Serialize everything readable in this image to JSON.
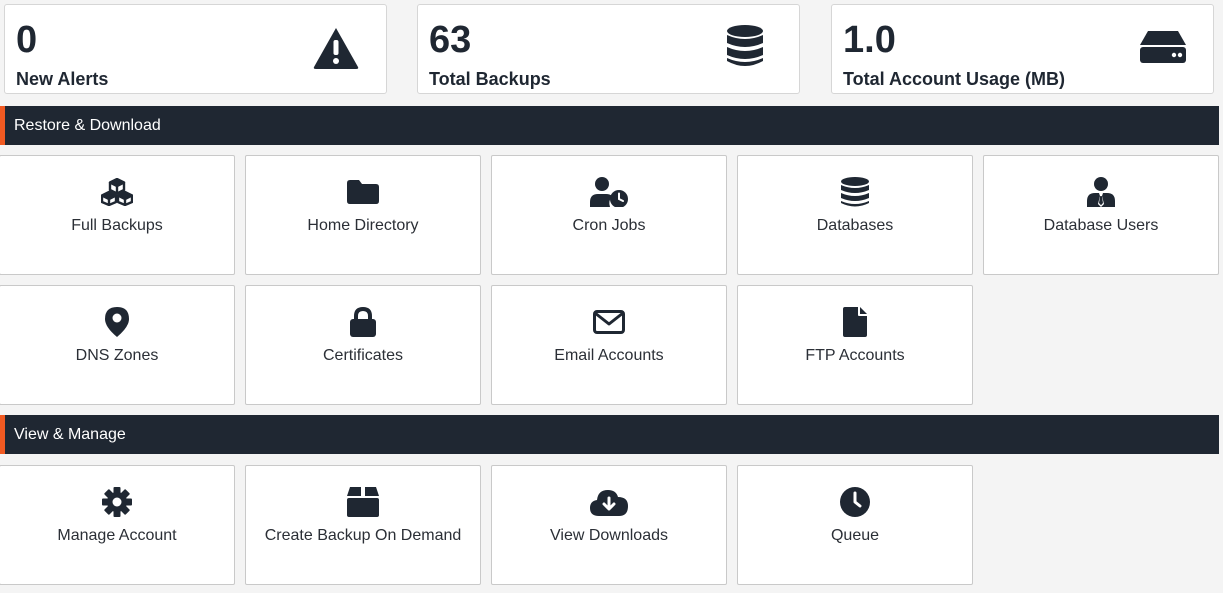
{
  "stats": [
    {
      "value": "0",
      "label": "New Alerts",
      "icon": "warning-icon"
    },
    {
      "value": "63",
      "label": "Total Backups",
      "icon": "database-icon"
    },
    {
      "value": "1.0",
      "label": "Total Account Usage (MB)",
      "icon": "hard-drive-icon"
    }
  ],
  "sections": {
    "restore": {
      "title": "Restore & Download",
      "tiles": [
        {
          "label": "Full Backups",
          "icon": "cubes-icon"
        },
        {
          "label": "Home Directory",
          "icon": "folder-icon"
        },
        {
          "label": "Cron Jobs",
          "icon": "user-clock-icon"
        },
        {
          "label": "Databases",
          "icon": "database-icon"
        },
        {
          "label": "Database Users",
          "icon": "user-tie-icon"
        },
        {
          "label": "DNS Zones",
          "icon": "map-marker-icon"
        },
        {
          "label": "Certificates",
          "icon": "lock-icon"
        },
        {
          "label": "Email Accounts",
          "icon": "envelope-icon"
        },
        {
          "label": "FTP Accounts",
          "icon": "file-icon"
        }
      ]
    },
    "manage": {
      "title": "View & Manage",
      "tiles": [
        {
          "label": "Manage Account",
          "icon": "gear-icon"
        },
        {
          "label": "Create Backup On Demand",
          "icon": "box-icon"
        },
        {
          "label": "View Downloads",
          "icon": "cloud-download-icon"
        },
        {
          "label": "Queue",
          "icon": "clock-icon"
        }
      ]
    }
  },
  "colors": {
    "header_bg": "#1f2732",
    "accent": "#f15a22",
    "icon": "#1f2732"
  }
}
